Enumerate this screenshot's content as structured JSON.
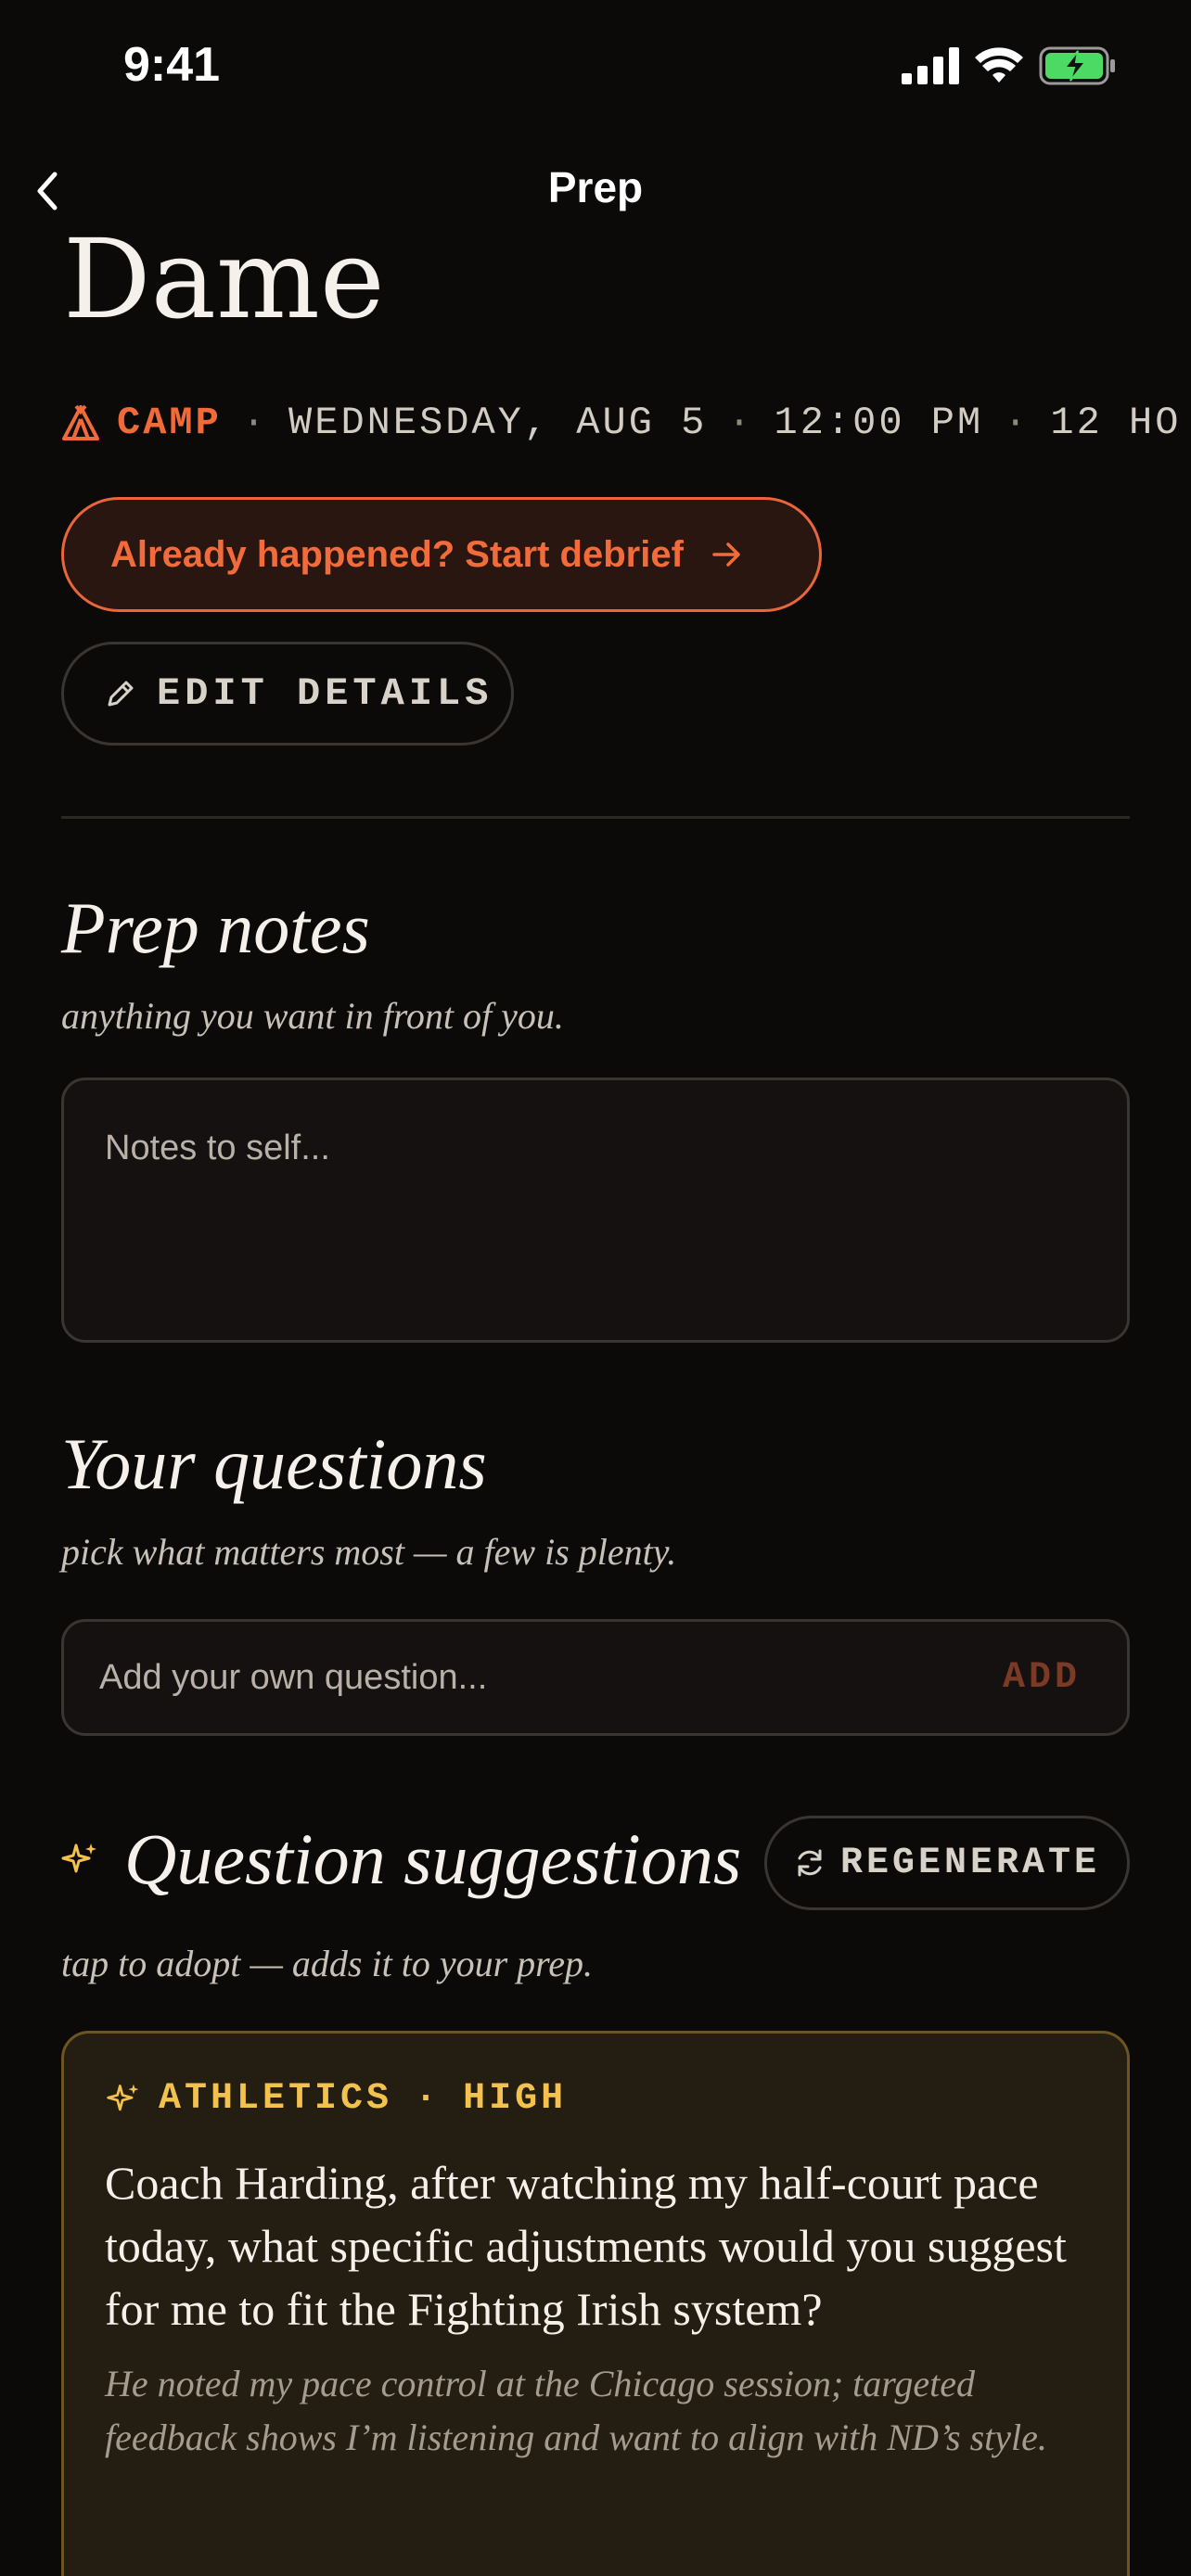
{
  "status": {
    "time": "9:41"
  },
  "nav": {
    "title": "Prep"
  },
  "event": {
    "title": "Dame",
    "type": "CAMP",
    "meta_parts": [
      "WEDNESDAY, AUG 5",
      "12:00 PM",
      "12 HO"
    ]
  },
  "actions": {
    "debrief_label": "Already happened? Start debrief",
    "edit_label": "EDIT DETAILS"
  },
  "notes": {
    "title": "Prep notes",
    "subtitle": "anything you want in front of you.",
    "placeholder": "Notes to self..."
  },
  "questions": {
    "title": "Your questions",
    "subtitle": "pick what matters most — a few is plenty.",
    "input_placeholder": "Add your own question...",
    "add_label": "ADD"
  },
  "suggestions": {
    "title": "Question suggestions",
    "regenerate_label": "REGENERATE",
    "subtitle": "tap to adopt — adds it to your prep.",
    "items": [
      {
        "category": "ATHLETICS",
        "priority": "HIGH",
        "question": "Coach Harding, after watching my half-court pace today, what specific adjustments would you suggest for me to fit the Fighting Irish system?",
        "rationale": "He noted my pace control at the Chicago session; targeted feedback shows I’m listening and want to align with ND’s style."
      }
    ]
  },
  "colors": {
    "accent": "#f06a3a",
    "gold": "#f2c14e",
    "background": "#0c0a09"
  }
}
